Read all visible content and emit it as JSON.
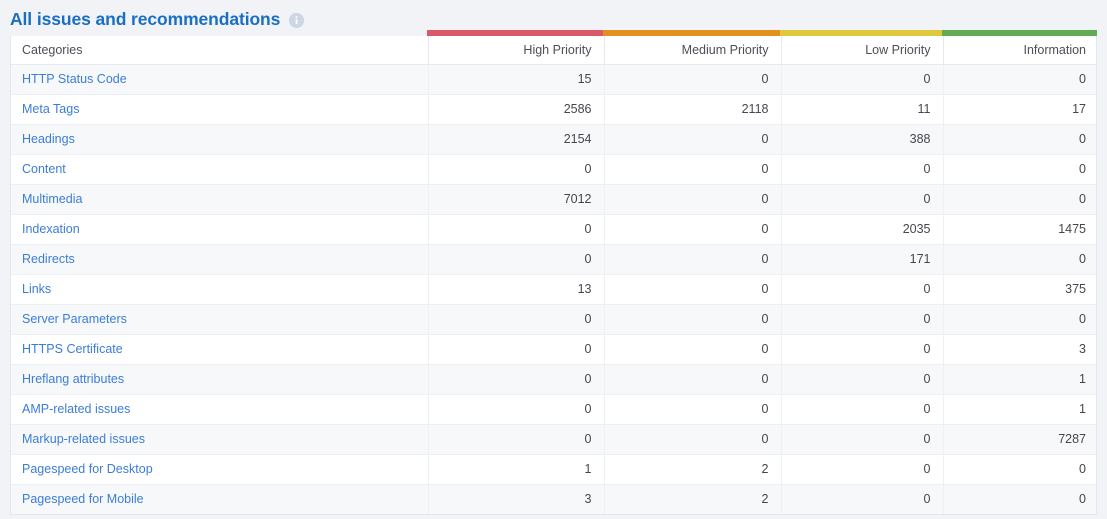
{
  "header": {
    "title": "All issues and recommendations",
    "info_icon": "info-circle-icon"
  },
  "table": {
    "columns": [
      {
        "key": "category",
        "label": "Categories",
        "align": "left",
        "accent": null
      },
      {
        "key": "high_priority",
        "label": "High Priority",
        "align": "right",
        "accent": "#d9596b"
      },
      {
        "key": "medium_priority",
        "label": "Medium Priority",
        "align": "right",
        "accent": "#e2901f"
      },
      {
        "key": "low_priority",
        "label": "Low Priority",
        "align": "right",
        "accent": "#dfc83c"
      },
      {
        "key": "information",
        "label": "Information",
        "align": "right",
        "accent": "#63ab55"
      }
    ],
    "rows": [
      {
        "category": "HTTP Status Code",
        "high_priority": "15",
        "medium_priority": "0",
        "low_priority": "0",
        "information": "0"
      },
      {
        "category": "Meta Tags",
        "high_priority": "2586",
        "medium_priority": "2118",
        "low_priority": "11",
        "information": "17"
      },
      {
        "category": "Headings",
        "high_priority": "2154",
        "medium_priority": "0",
        "low_priority": "388",
        "information": "0"
      },
      {
        "category": "Content",
        "high_priority": "0",
        "medium_priority": "0",
        "low_priority": "0",
        "information": "0"
      },
      {
        "category": "Multimedia",
        "high_priority": "7012",
        "medium_priority": "0",
        "low_priority": "0",
        "information": "0"
      },
      {
        "category": "Indexation",
        "high_priority": "0",
        "medium_priority": "0",
        "low_priority": "2035",
        "information": "1475"
      },
      {
        "category": "Redirects",
        "high_priority": "0",
        "medium_priority": "0",
        "low_priority": "171",
        "information": "0"
      },
      {
        "category": "Links",
        "high_priority": "13",
        "medium_priority": "0",
        "low_priority": "0",
        "information": "375"
      },
      {
        "category": "Server Parameters",
        "high_priority": "0",
        "medium_priority": "0",
        "low_priority": "0",
        "information": "0"
      },
      {
        "category": "HTTPS Certificate",
        "high_priority": "0",
        "medium_priority": "0",
        "low_priority": "0",
        "information": "3"
      },
      {
        "category": "Hreflang attributes",
        "high_priority": "0",
        "medium_priority": "0",
        "low_priority": "0",
        "information": "1"
      },
      {
        "category": "AMP-related issues",
        "high_priority": "0",
        "medium_priority": "0",
        "low_priority": "0",
        "information": "1"
      },
      {
        "category": "Markup-related issues",
        "high_priority": "0",
        "medium_priority": "0",
        "low_priority": "0",
        "information": "7287"
      },
      {
        "category": "Pagespeed for Desktop",
        "high_priority": "1",
        "medium_priority": "2",
        "low_priority": "0",
        "information": "0"
      },
      {
        "category": "Pagespeed for Mobile",
        "high_priority": "3",
        "medium_priority": "2",
        "low_priority": "0",
        "information": "0"
      }
    ]
  },
  "theme": {
    "page_background": "#f2f3f7",
    "title_color": "#1a6fc4",
    "link_color": "#3b7dd8",
    "row_stripe": "#f7f8fa",
    "border": "#e6e9f0"
  }
}
